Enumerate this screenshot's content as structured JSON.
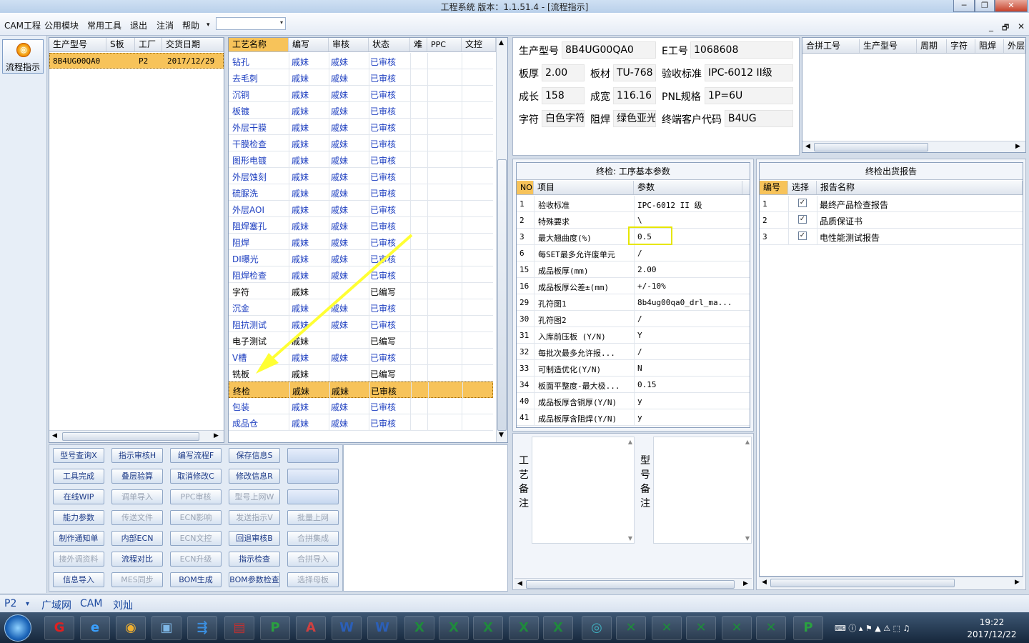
{
  "window": {
    "title": "工程系统  版本：1.1.51.4 - [流程指示]",
    "minimize": "─",
    "restore": "❐",
    "close": "✕"
  },
  "menu": {
    "items": [
      "CAM工程",
      "公用模块",
      "常用工具",
      "退出",
      "注消",
      "帮助"
    ],
    "help_arrow": "▾",
    "combo_value": "",
    "combo_arrow": "▾"
  },
  "secondary_controls": {
    "minimize": "_",
    "restore": "🗗",
    "close": "✕"
  },
  "left_nav": {
    "flow_label": "流程指示"
  },
  "order_table": {
    "headers": [
      "生产型号",
      "S板",
      "工厂",
      "交货日期"
    ],
    "rows": [
      {
        "model": "8B4UG00QA0",
        "s_board": "",
        "factory": "P2",
        "date": "2017/12/29"
      }
    ]
  },
  "process_table": {
    "headers": [
      "工艺名称",
      "编写",
      "审核",
      "状态",
      "难",
      "PPC",
      "文控"
    ],
    "rows": [
      {
        "name": "钻孔",
        "writer": "戚妹",
        "reviewer": "戚妹",
        "status": "已审核"
      },
      {
        "name": "去毛刺",
        "writer": "戚妹",
        "reviewer": "戚妹",
        "status": "已审核"
      },
      {
        "name": "沉铜",
        "writer": "戚妹",
        "reviewer": "戚妹",
        "status": "已审核"
      },
      {
        "name": "板镀",
        "writer": "戚妹",
        "reviewer": "戚妹",
        "status": "已审核"
      },
      {
        "name": "外层干膜",
        "writer": "戚妹",
        "reviewer": "戚妹",
        "status": "已审核"
      },
      {
        "name": "干膜检查",
        "writer": "戚妹",
        "reviewer": "戚妹",
        "status": "已审核"
      },
      {
        "name": "图形电镀",
        "writer": "戚妹",
        "reviewer": "戚妹",
        "status": "已审核"
      },
      {
        "name": "外层蚀刻",
        "writer": "戚妹",
        "reviewer": "戚妹",
        "status": "已审核"
      },
      {
        "name": "硫脲洗",
        "writer": "戚妹",
        "reviewer": "戚妹",
        "status": "已审核"
      },
      {
        "name": "外层AOI",
        "writer": "戚妹",
        "reviewer": "戚妹",
        "status": "已审核"
      },
      {
        "name": "阻焊塞孔",
        "writer": "戚妹",
        "reviewer": "戚妹",
        "status": "已审核"
      },
      {
        "name": "阻焊",
        "writer": "戚妹",
        "reviewer": "戚妹",
        "status": "已审核"
      },
      {
        "name": "DI曝光",
        "writer": "戚妹",
        "reviewer": "戚妹",
        "status": "已审核"
      },
      {
        "name": "阻焊检查",
        "writer": "戚妹",
        "reviewer": "戚妹",
        "status": "已审核"
      },
      {
        "name": "字符",
        "writer": "戚妹",
        "reviewer": "",
        "status": "已编写"
      },
      {
        "name": "沉金",
        "writer": "戚妹",
        "reviewer": "戚妹",
        "status": "已审核"
      },
      {
        "name": "阻抗测试",
        "writer": "戚妹",
        "reviewer": "戚妹",
        "status": "已审核"
      },
      {
        "name": "电子测试",
        "writer": "戚妹",
        "reviewer": "",
        "status": "已编写"
      },
      {
        "name": "V槽",
        "writer": "戚妹",
        "reviewer": "戚妹",
        "status": "已审核"
      },
      {
        "name": "铣板",
        "writer": "戚妹",
        "reviewer": "",
        "status": "已编写"
      },
      {
        "name": "终检",
        "writer": "戚妹",
        "reviewer": "戚妹",
        "status": "已审核"
      },
      {
        "name": "包装",
        "writer": "戚妹",
        "reviewer": "戚妹",
        "status": "已审核"
      },
      {
        "name": "成品仓",
        "writer": "戚妹",
        "reviewer": "戚妹",
        "status": "已审核"
      }
    ],
    "selected_index": 20
  },
  "actions": {
    "col1": [
      "型号查询X",
      "工具完成",
      "在线WIP",
      "能力参数",
      "制作通知单",
      "接外调资料",
      "信息导入"
    ],
    "col2": [
      "指示审核H",
      "叠层验算",
      "调单导入",
      "传送文件",
      "内部ECN",
      "流程对比",
      "MES同步"
    ],
    "col3": [
      "编写流程F",
      "取消修改C",
      "PPC审核",
      "ECN影响",
      "ECN文控",
      "ECN升级",
      "BOM生成"
    ],
    "col4": [
      "保存信息S",
      "修改信息R",
      "型号上网W",
      "发送指示V",
      "回退审核B",
      "指示检查",
      "BOM参数检查"
    ],
    "col5": [
      "",
      "",
      "",
      "批量上网",
      "合拼集成",
      "合拼导入",
      "选择母板"
    ]
  },
  "info": {
    "model_label": "生产型号",
    "model_value": "8B4UG00QA0",
    "eno_label": "E工号",
    "eno_value": "1068608",
    "thickness_label": "板厚",
    "thickness_value": "2.00",
    "material_label": "板材",
    "material_value": "TU-768",
    "standard_label": "验收标准",
    "standard_value": "IPC-6012 II级",
    "length_label": "成长",
    "length_value": "158",
    "width_label": "成宽",
    "width_value": "116.16",
    "pnl_label": "PNL规格",
    "pnl_value": "1P=6U",
    "char_label": "字符",
    "char_value": "白色字符",
    "mask_label": "阻焊",
    "mask_value": "绿色亚光",
    "customer_label": "终端客户代码",
    "customer_value": "B4UG"
  },
  "combine_table": {
    "headers": [
      "合拼工号",
      "生产型号",
      "周期",
      "字符",
      "阻焊",
      "外层"
    ]
  },
  "params": {
    "title": "终检: 工序基本参数",
    "headers": [
      "NO",
      "项目",
      "参数"
    ],
    "rows": [
      {
        "no": "1",
        "item": "验收标准",
        "value": "IPC-6012 II 级"
      },
      {
        "no": "2",
        "item": "特殊要求",
        "value": "\\"
      },
      {
        "no": "3",
        "item": "最大翘曲度(%)",
        "value": "0.5"
      },
      {
        "no": "6",
        "item": "每SET最多允许废单元",
        "value": "/"
      },
      {
        "no": "15",
        "item": "成品板厚(mm)",
        "value": "2.00"
      },
      {
        "no": "16",
        "item": "成品板厚公差±(mm)",
        "value": "+/-10%"
      },
      {
        "no": "29",
        "item": "孔符图1",
        "value": "8b4ug00qa0_drl_ma..."
      },
      {
        "no": "30",
        "item": "孔符图2",
        "value": "/"
      },
      {
        "no": "31",
        "item": "入库前压板 (Y/N)",
        "value": "Y"
      },
      {
        "no": "32",
        "item": "每批次最多允许报...",
        "value": "/"
      },
      {
        "no": "33",
        "item": "可制造优化(Y/N)",
        "value": "N"
      },
      {
        "no": "34",
        "item": "板面平整度-最大极...",
        "value": "0.15"
      },
      {
        "no": "40",
        "item": "成品板厚含铜厚(Y/N)",
        "value": "y"
      },
      {
        "no": "41",
        "item": "成品板厚含阻焊(Y/N)",
        "value": "y"
      }
    ]
  },
  "report": {
    "title": "终检出货报告",
    "headers": [
      "编号",
      "选择",
      "报告名称"
    ],
    "rows": [
      {
        "no": "1",
        "checked": "✓",
        "name": "最终产品检查报告"
      },
      {
        "no": "2",
        "checked": "✓",
        "name": "品质保证书"
      },
      {
        "no": "3",
        "checked": "✓",
        "name": "电性能测试报告"
      }
    ]
  },
  "notes": {
    "process_label": [
      "工",
      "艺",
      "备",
      "注"
    ],
    "model_label": [
      "型",
      "号",
      "备",
      "注"
    ]
  },
  "status_bar": {
    "factory": "P2",
    "arrow": "▾",
    "items": [
      "广域网",
      "CAM",
      "刘灿"
    ]
  },
  "taskbar": {
    "time": "19:22",
    "date": "2017/12/22"
  },
  "colors": {
    "selection": "#f7c35a",
    "highlight_box": "#e6e600",
    "arrow": "#ffff33",
    "link_blue": "#1e3fc0"
  }
}
